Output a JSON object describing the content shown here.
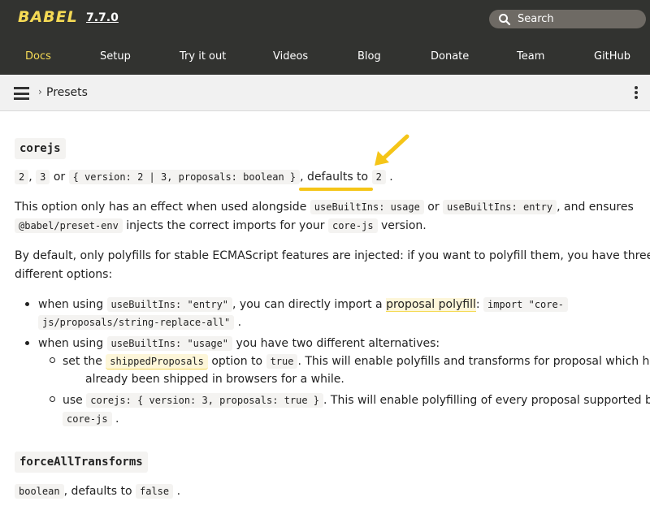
{
  "header": {
    "logo": "BABEL",
    "version": "7.7.0",
    "search_placeholder": "Search"
  },
  "nav": [
    "Docs",
    "Setup",
    "Try it out",
    "Videos",
    "Blog",
    "Donate",
    "Team",
    "GitHub"
  ],
  "breadcrumb": {
    "separator": "›",
    "current": "Presets"
  },
  "content": {
    "corejs_heading": "corejs",
    "corejs_values": {
      "v1": "2",
      "c1": ",",
      "v2": "3",
      "or": "or",
      "v3": "{ version: 2 | 3, proposals: boolean }",
      "defaults_to": ", defaults to",
      "default_value": "2",
      "end": "."
    },
    "para1": {
      "t1": "This option only has an effect when used alongside",
      "code1": "useBuiltIns: usage",
      "t2": "or",
      "code2": "useBuiltIns: entry",
      "t3": ", and ensures",
      "code3": "@babel/preset-env",
      "t4": "injects the correct imports for your",
      "code4": "core-js",
      "t5": "version."
    },
    "para2": {
      "line1": "By default, only polyfills for stable ECMAScript features are injected: if you want to polyfill them, you have three",
      "line2": "different options:"
    },
    "bullet1": {
      "t1": "when using",
      "code1": "useBuiltIns: \"entry\"",
      "t2": ", you can directly import a",
      "link": "proposal polyfill",
      "t3": ":",
      "code2a": "import \"core-",
      "code2b": "js/proposals/string-replace-all\"",
      "end": "."
    },
    "bullet2": {
      "t1": "when using",
      "code1": "useBuiltIns: \"usage\"",
      "t2": "you have two different alternatives:"
    },
    "sub1": {
      "t1": "set the",
      "code1": "shippedProposals",
      "t2": "option to",
      "code2": "true",
      "t3": ". This will enable polyfills and transforms for proposal which have",
      "line2": "already been shipped in browsers for a while."
    },
    "sub2": {
      "t1": "use",
      "code1": "corejs: { version: 3, proposals: true }",
      "t2": ". This will enable polyfilling of every proposal supported by",
      "code2": "core-js",
      "end": "."
    },
    "force_heading": "forceAllTransforms",
    "force_line": {
      "code1": "boolean",
      "t1": ", defaults to",
      "code2": "false",
      "end": "."
    }
  },
  "colors": {
    "header_bg": "#323330",
    "accent": "#f5da55",
    "annotation": "#f5c518"
  }
}
